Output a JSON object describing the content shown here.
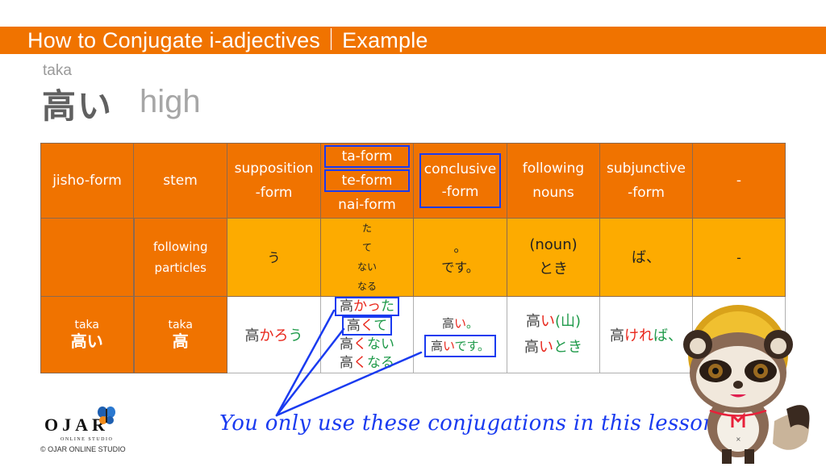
{
  "banner": {
    "title": "How to Conjugate i-adjectives｜Example",
    "color": "#f07300"
  },
  "word": {
    "ruby": "taka",
    "kanji": "高い",
    "meaning": "high"
  },
  "table": {
    "header": {
      "jisho": "jisho-form",
      "stem": "stem",
      "supposition": [
        "supposition",
        "-form"
      ],
      "ta_te_nai": [
        "ta-form",
        "te-form",
        "nai-form"
      ],
      "conclusive": [
        "conclusive",
        "-form"
      ],
      "nouns": [
        "following",
        "nouns"
      ],
      "subjunctive": [
        "subjunctive",
        "-form"
      ],
      "last": "-"
    },
    "particles_row": {
      "label": [
        "following",
        "particles"
      ],
      "supposition": "う",
      "ta_te_nai": [
        "た",
        "て",
        "ない",
        "なる"
      ],
      "conclusive": [
        "。",
        "です。"
      ],
      "nouns": [
        "(noun)",
        "とき"
      ],
      "subjunctive": "ば、",
      "last": "-"
    },
    "example_row": {
      "jisho": {
        "ruby": "taka",
        "kanji": "高い"
      },
      "stem": {
        "ruby": "taka",
        "kanji": "高"
      },
      "supposition": {
        "stem": "高",
        "ending_red": "かろ",
        "ending_green": "う"
      },
      "ta_te_nai": [
        {
          "stem": "高",
          "red": "かっ",
          "green": "た"
        },
        {
          "stem": "高",
          "red": "く",
          "green": "て"
        },
        {
          "stem": "高",
          "red": "く",
          "green": "ない"
        },
        {
          "stem": "高",
          "red": "く",
          "green": "なる"
        }
      ],
      "conclusive": [
        {
          "stem": "高",
          "red": "い",
          "green": "。"
        },
        {
          "stem": "高",
          "red": "い",
          "green": "です。"
        }
      ],
      "nouns": [
        {
          "stem": "高",
          "red": "い",
          "green": "(山)"
        },
        {
          "stem": "高",
          "red": "い",
          "green": "とき"
        }
      ],
      "subjunctive": {
        "stem": "高",
        "red": "けれ",
        "green": "ば、"
      },
      "last": ""
    },
    "colors": {
      "header": "#f07300",
      "particles": "#fdab00",
      "highlight": "#1a3bf0",
      "red": "#e8261b",
      "green": "#1f9a4a"
    }
  },
  "note": "You only use these conjugations in this lesson.",
  "logo": {
    "name": "OJAR",
    "sub": "ONLINE STUDIO",
    "copyright": "© OJAR ONLINE STUDIO"
  }
}
